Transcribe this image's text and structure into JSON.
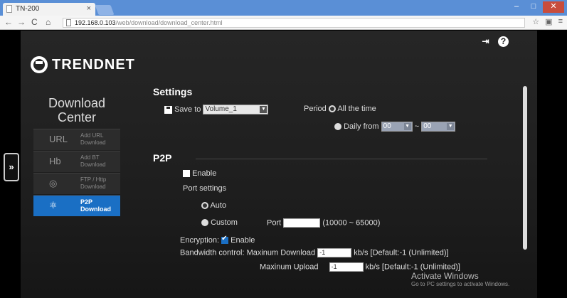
{
  "browser": {
    "tab_title": "TN-200",
    "url_host": "192.168.0.103",
    "url_path": "/web/download/download_center.html",
    "window_controls": [
      "–",
      "□",
      "✕"
    ]
  },
  "header": {
    "logo_text": "TRENDNET"
  },
  "sidebar": {
    "title_line1": "Download",
    "title_line2": "Center",
    "items": [
      {
        "icon": "URL",
        "label_line1": "Add URL",
        "label_line2": "Download"
      },
      {
        "icon": "Hb",
        "label_line1": "Add BT",
        "label_line2": "Download"
      },
      {
        "icon": "◎",
        "label_line1": "FTP / Http",
        "label_line2": "Download"
      },
      {
        "icon": "⚛",
        "label_line1": "P2P",
        "label_line2": "Download"
      }
    ],
    "expand_label": "»"
  },
  "settings": {
    "title": "Settings",
    "save_to_label": "Save to",
    "save_to_value": "Volume_1",
    "period_label": "Period",
    "all_time_label": "All the time",
    "daily_from_label": "Daily from",
    "from_value": "00",
    "to_separator": "~",
    "to_value": "00"
  },
  "p2p": {
    "title": "P2P",
    "enable_label": "Enable",
    "port_settings_label": "Port settings",
    "auto_label": "Auto",
    "custom_label": "Custom",
    "port_label": "Port",
    "port_range": "(10000 ~ 65000)",
    "encryption_label": "Encryption:",
    "encryption_enable_label": "Enable",
    "bandwidth_label": "Bandwidth control:",
    "max_download_label": "Maxinum Download",
    "max_download_value": "-1",
    "max_upload_label": "Maxinum Upload",
    "max_upload_value": "-1",
    "rate_hint": "kb/s [Default:-1 (Unlimited)]"
  },
  "watermark": {
    "title": "Activate Windows",
    "subtitle": "Go to PC settings to activate Windows."
  }
}
